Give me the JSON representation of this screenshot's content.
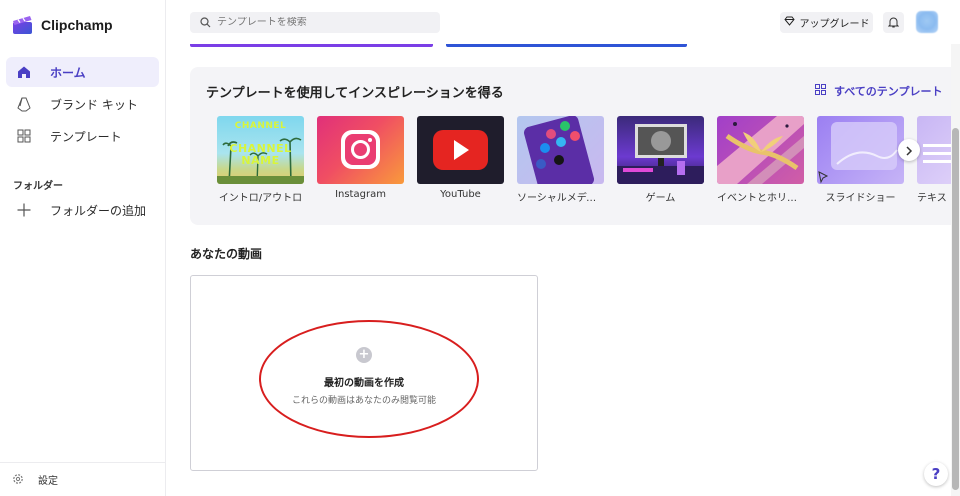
{
  "app": {
    "name": "Clipchamp"
  },
  "sidebar": {
    "items": [
      {
        "label": "ホーム",
        "icon": "home-icon",
        "active": true
      },
      {
        "label": "ブランド キット",
        "icon": "brand-kit-icon"
      },
      {
        "label": "テンプレート",
        "icon": "templates-icon"
      }
    ],
    "folders_title": "フォルダー",
    "add_folder": "フォルダーの追加",
    "settings": "設定"
  },
  "topbar": {
    "search_placeholder": "テンプレートを検索",
    "upgrade_label": "アップグレード"
  },
  "templates": {
    "title": "テンプレートを使用してインスピレーションを得る",
    "all_label": "すべてのテンプレート",
    "items": [
      {
        "label": "イントロ/アウトロ",
        "overlay_top": "CHANNEL",
        "overlay_bottom": "NAME"
      },
      {
        "label": "Instagram"
      },
      {
        "label": "YouTube"
      },
      {
        "label": "ソーシャルメディ…"
      },
      {
        "label": "ゲーム"
      },
      {
        "label": "イベントとホリデ…"
      },
      {
        "label": "スライドショー"
      },
      {
        "label": "テキス"
      }
    ]
  },
  "videos": {
    "title": "あなたの動画",
    "create_title": "最初の動画を作成",
    "create_sub": "これらの動画はあなたのみ閲覧可能"
  },
  "help_label": "?",
  "colors": {
    "accent": "#4a3fc4",
    "annotation": "#d81e1e"
  }
}
